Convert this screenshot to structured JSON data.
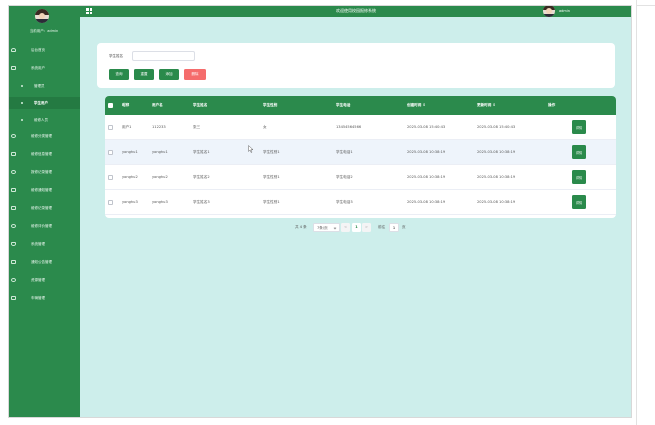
{
  "header": {
    "title": "欢迎使用校园报修系统",
    "user": "admin"
  },
  "sidebar": {
    "current_user": "当前用户：admin",
    "items": [
      {
        "label": "后台首页",
        "icon": "home-icon"
      },
      {
        "label": "系统用户",
        "icon": "table-icon"
      },
      {
        "label": "管理员",
        "sub": true
      },
      {
        "label": "学生用户",
        "sub": true,
        "active": true
      },
      {
        "label": "维修人员",
        "sub": true
      },
      {
        "label": "维修分类管理",
        "icon": "circle-icon"
      },
      {
        "label": "维修信息管理",
        "icon": "doc-icon"
      },
      {
        "label": "报修记录管理",
        "icon": "circle-icon"
      },
      {
        "label": "维修通知管理",
        "icon": "table-icon"
      },
      {
        "label": "维修记录管理",
        "icon": "doc-icon"
      },
      {
        "label": "维修评价管理",
        "icon": "circle-icon"
      },
      {
        "label": "系统管理",
        "icon": "shield-icon"
      },
      {
        "label": "通知公告管理",
        "icon": "doc-icon"
      },
      {
        "label": "资源管理",
        "icon": "circle-icon"
      },
      {
        "label": "车辆管理",
        "icon": "table-icon"
      }
    ]
  },
  "search": {
    "label": "学生姓名",
    "value": "",
    "placeholder": "",
    "buttons": {
      "query": "查询",
      "reset": "重置",
      "add": "添加",
      "delete": "删除"
    }
  },
  "table": {
    "columns": [
      "昵称",
      "用户名",
      "学生姓名",
      "学生性别",
      "学生电话",
      "创建时间 ⇕",
      "更新时间 ⇕",
      "操作"
    ],
    "rows": [
      {
        "nickname": "用户1",
        "username": "112233",
        "name": "张三",
        "gender": "女",
        "phone": "13454564566",
        "created": "2025-03-08 15:40:43",
        "updated": "2025-03-08 15:40:43",
        "action": "详情"
      },
      {
        "nickname": "yonghu1",
        "username": "yonghu1",
        "name": "学生姓名1",
        "gender": "学生性别1",
        "phone": "学生电话1",
        "created": "2025-03-08 10:38:19",
        "updated": "2025-03-08 10:38:19",
        "action": "详情"
      },
      {
        "nickname": "yonghu2",
        "username": "yonghu2",
        "name": "学生姓名2",
        "gender": "学生性别1",
        "phone": "学生电话2",
        "created": "2025-03-08 10:38:19",
        "updated": "2025-03-08 10:38:19",
        "action": "详情"
      },
      {
        "nickname": "yonghu3",
        "username": "yonghu3",
        "name": "学生姓名3",
        "gender": "学生性别1",
        "phone": "学生电话3",
        "created": "2025-03-08 10:38:19",
        "updated": "2025-03-08 10:38:19",
        "action": "详情"
      }
    ]
  },
  "pagination": {
    "total": "共 4 条",
    "page_size": "7条/页",
    "prev": "<",
    "current_page": "1",
    "next": ">",
    "goto_label": "前往",
    "goto_value": "1",
    "page_suffix": "页"
  },
  "colors": {
    "primary": "#2b8a4c",
    "background": "#cdeeeb",
    "danger": "#f56c6c"
  }
}
